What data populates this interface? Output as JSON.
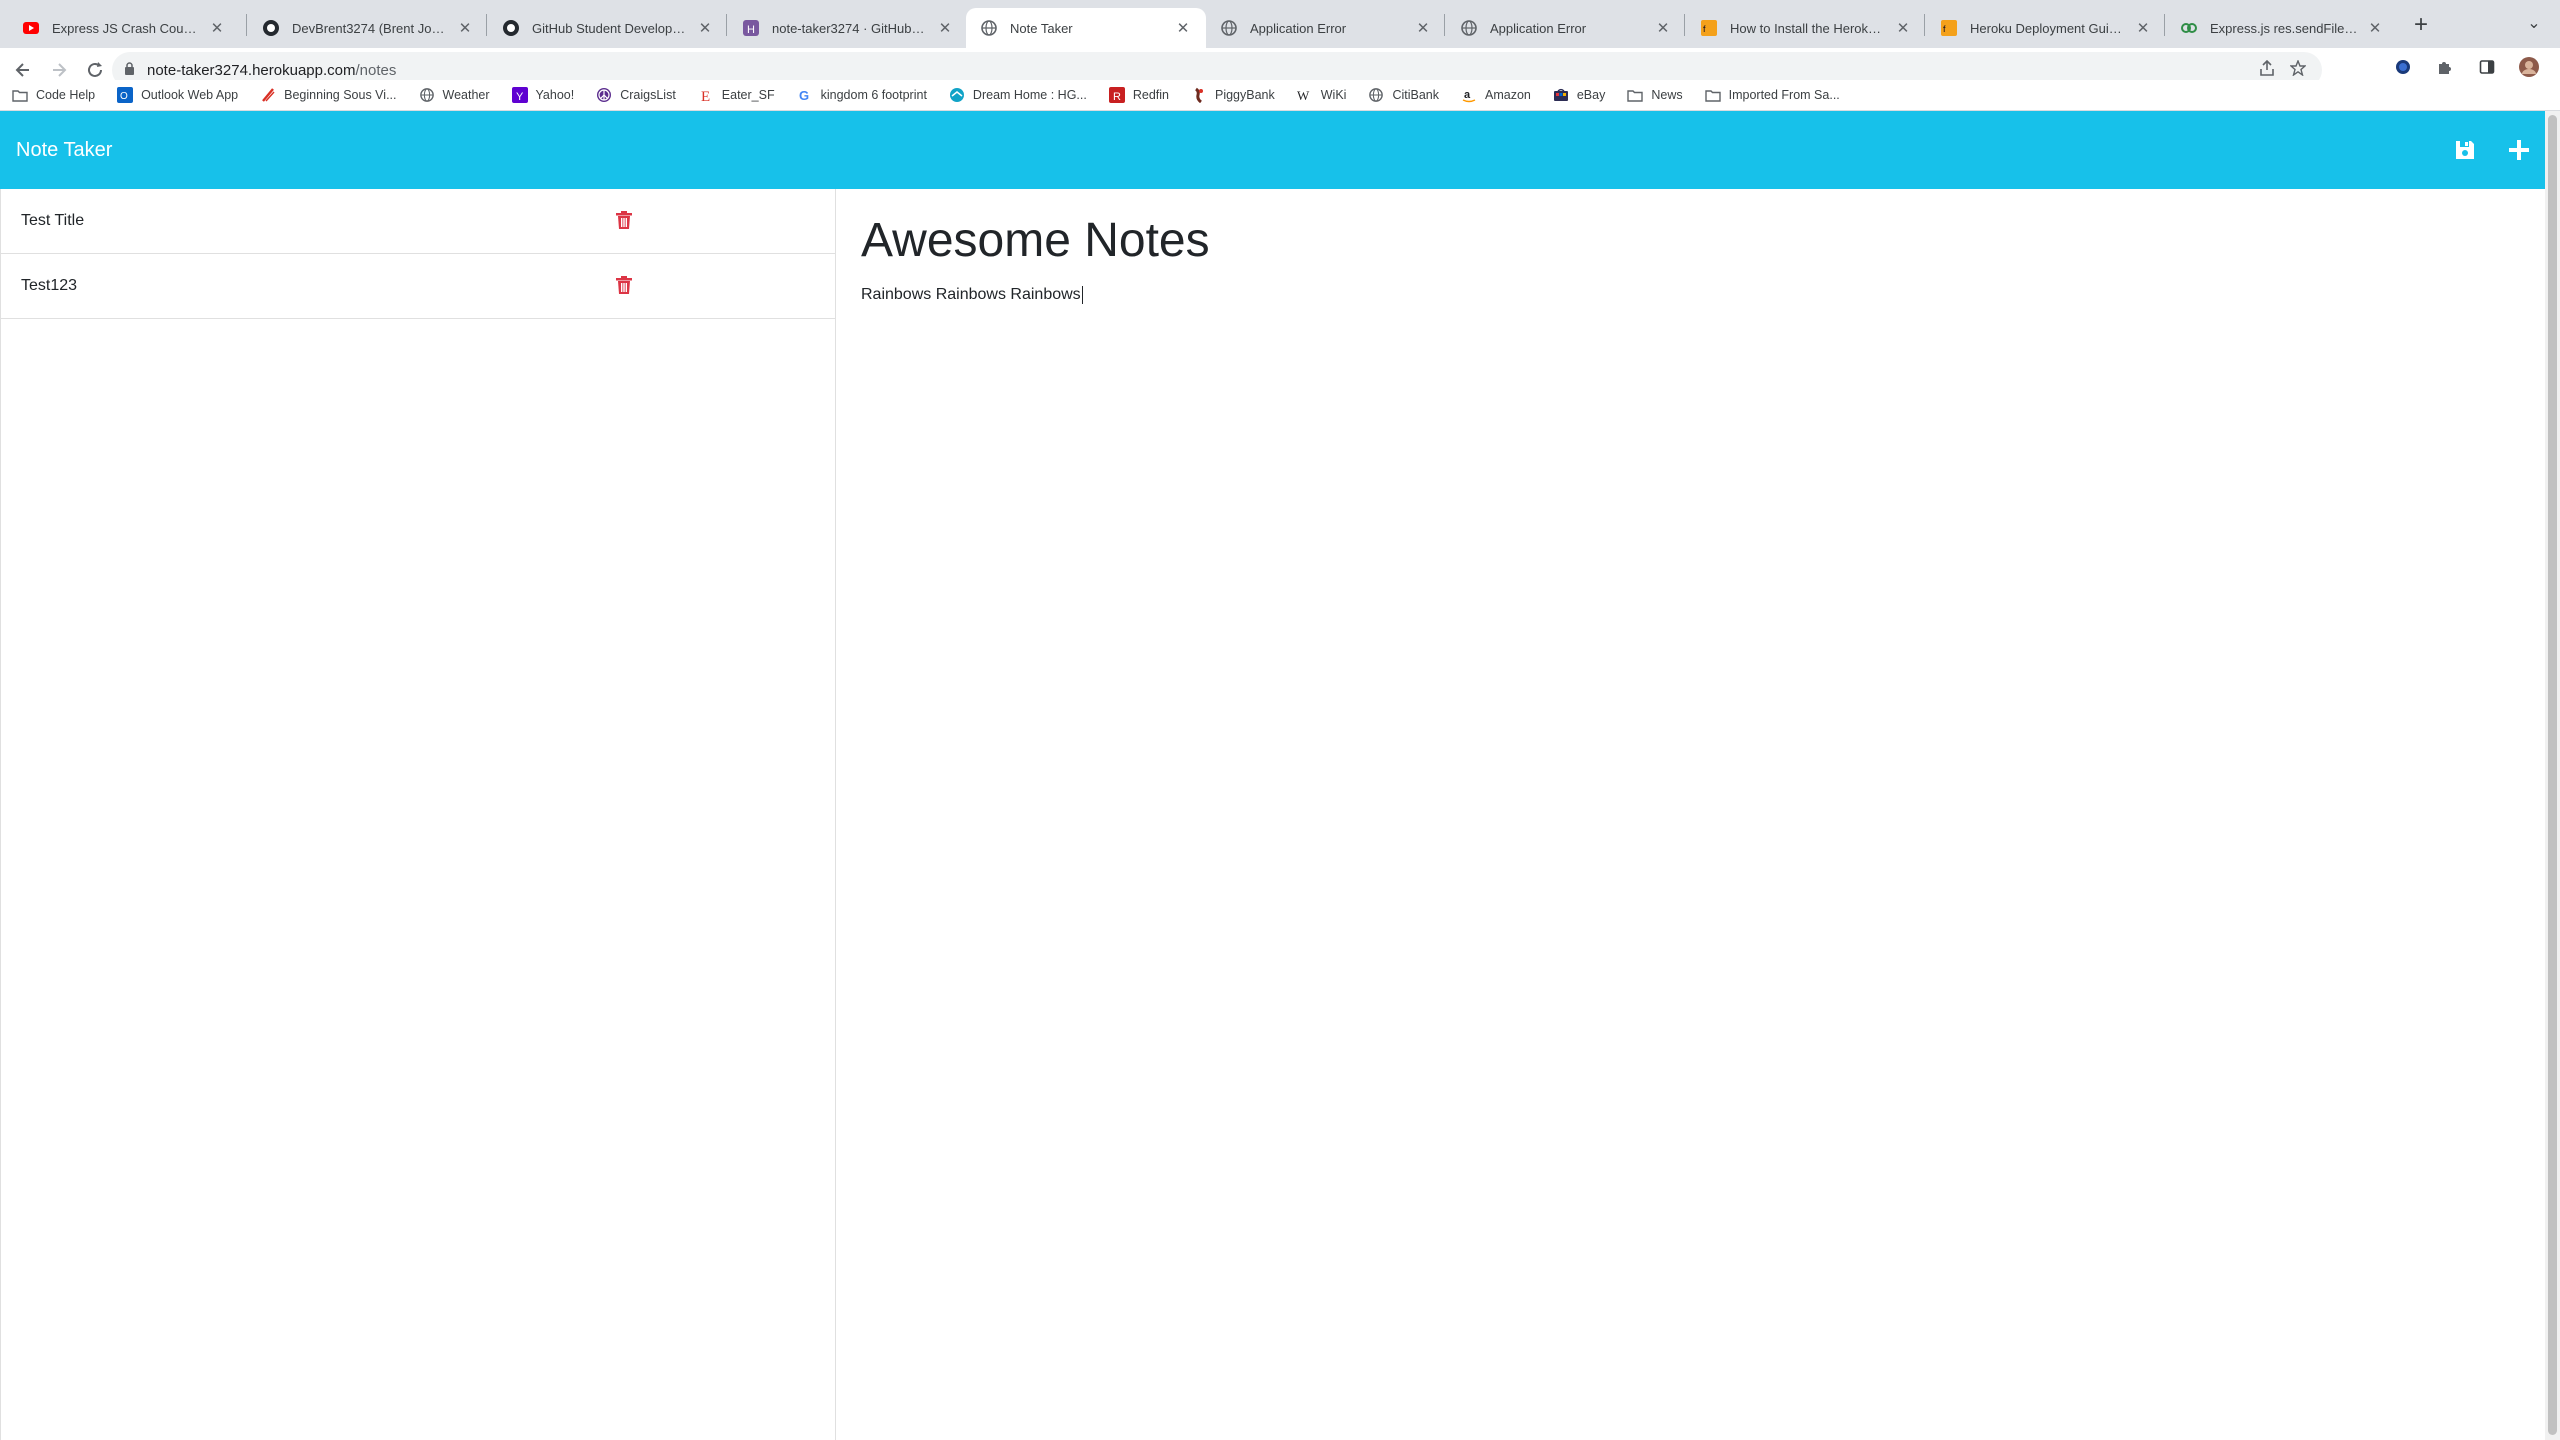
{
  "browser": {
    "tabs": [
      {
        "label": "Express JS Crash Course - You",
        "icon": "youtube-icon"
      },
      {
        "label": "DevBrent3274 (Brent Johnson)",
        "icon": "github-icon"
      },
      {
        "label": "GitHub Student Developer Pac",
        "icon": "github-icon"
      },
      {
        "label": "note-taker3274 · GitHub | Hero",
        "icon": "heroku-icon"
      },
      {
        "label": "Note Taker",
        "icon": "globe-icon",
        "active": true
      },
      {
        "label": "Application Error",
        "icon": "globe-icon"
      },
      {
        "label": "Application Error",
        "icon": "globe-icon"
      },
      {
        "label": "How to Install the Heroku CLI |",
        "icon": "freecodecamp-icon"
      },
      {
        "label": "Heroku Deployment Guide | Th",
        "icon": "freecodecamp-icon"
      },
      {
        "label": "Express.js res.sendFile() Functi",
        "icon": "geeksforgeeks-icon"
      }
    ],
    "url_host": "note-taker3274.herokuapp.com",
    "url_path": "/notes",
    "bookmarks": [
      {
        "label": "Code Help",
        "icon": "folder-icon"
      },
      {
        "label": "Outlook Web App",
        "icon": "outlook-icon"
      },
      {
        "label": "Beginning Sous Vi...",
        "icon": "sousvide-icon"
      },
      {
        "label": "Weather",
        "icon": "globe-icon"
      },
      {
        "label": "Yahoo!",
        "icon": "yahoo-icon"
      },
      {
        "label": "CraigsList",
        "icon": "peace-icon"
      },
      {
        "label": "Eater_SF",
        "icon": "eater-icon"
      },
      {
        "label": "kingdom 6 footprint",
        "icon": "google-icon"
      },
      {
        "label": "Dream Home : HG...",
        "icon": "hgtv-icon"
      },
      {
        "label": "Redfin",
        "icon": "redfin-icon"
      },
      {
        "label": "PiggyBank",
        "icon": "piggybank-icon"
      },
      {
        "label": "WiKi",
        "icon": "wikipedia-icon"
      },
      {
        "label": "CitiBank",
        "icon": "globe-icon"
      },
      {
        "label": "Amazon",
        "icon": "amazon-icon"
      },
      {
        "label": "eBay",
        "icon": "ebay-icon"
      },
      {
        "label": "News",
        "icon": "folder-icon"
      },
      {
        "label": "Imported From Sa...",
        "icon": "folder-icon"
      }
    ]
  },
  "app": {
    "title": "Note Taker",
    "header_color": "#17c1ea",
    "delete_color": "#dc3545"
  },
  "notes": [
    {
      "title": "Test Title"
    },
    {
      "title": "Test123"
    }
  ],
  "active_note": {
    "title": "Awesome Notes",
    "body": "Rainbows Rainbows Rainbows"
  }
}
